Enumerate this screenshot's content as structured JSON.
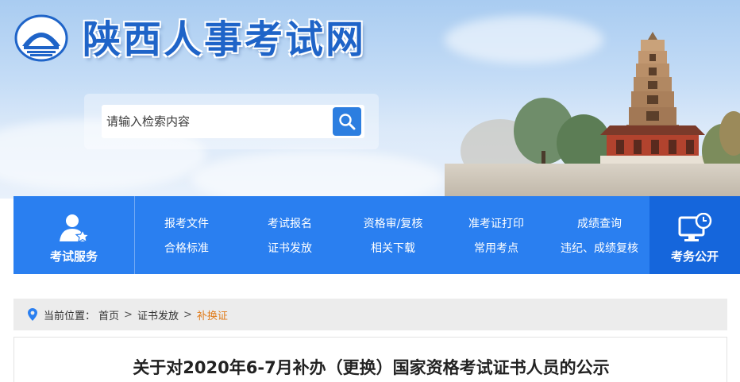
{
  "header": {
    "site_title": "陕西人事考试网",
    "logo_icon": "pagoda-logo-icon"
  },
  "search": {
    "placeholder": "请输入检索内容",
    "value": "",
    "button_icon": "search-icon"
  },
  "nav": {
    "left": {
      "label": "考试服务",
      "icon": "user-star-icon"
    },
    "links": [
      "报考文件",
      "考试报名",
      "资格审/复核",
      "准考证打印",
      "成绩查询",
      "合格标准",
      "证书发放",
      "相关下载",
      "常用考点",
      "违纪、成绩复核"
    ],
    "right": {
      "label": "考务公开",
      "icon": "monitor-clock-icon"
    }
  },
  "breadcrumb": {
    "prefix": "当前位置：",
    "items": [
      "首页",
      "证书发放"
    ],
    "current": "补换证",
    "separator": ">",
    "icon": "location-pin-icon"
  },
  "article": {
    "title": "关于对2020年6-7月补办（更换）国家资格考试证书人员的公示"
  },
  "colors": {
    "nav_blue": "#2a7ff0",
    "nav_right_blue": "#1566dc",
    "title_blue": "#1f64c8",
    "breadcrumb_current": "#e07b1a",
    "breadcrumb_bg": "#ececec"
  }
}
